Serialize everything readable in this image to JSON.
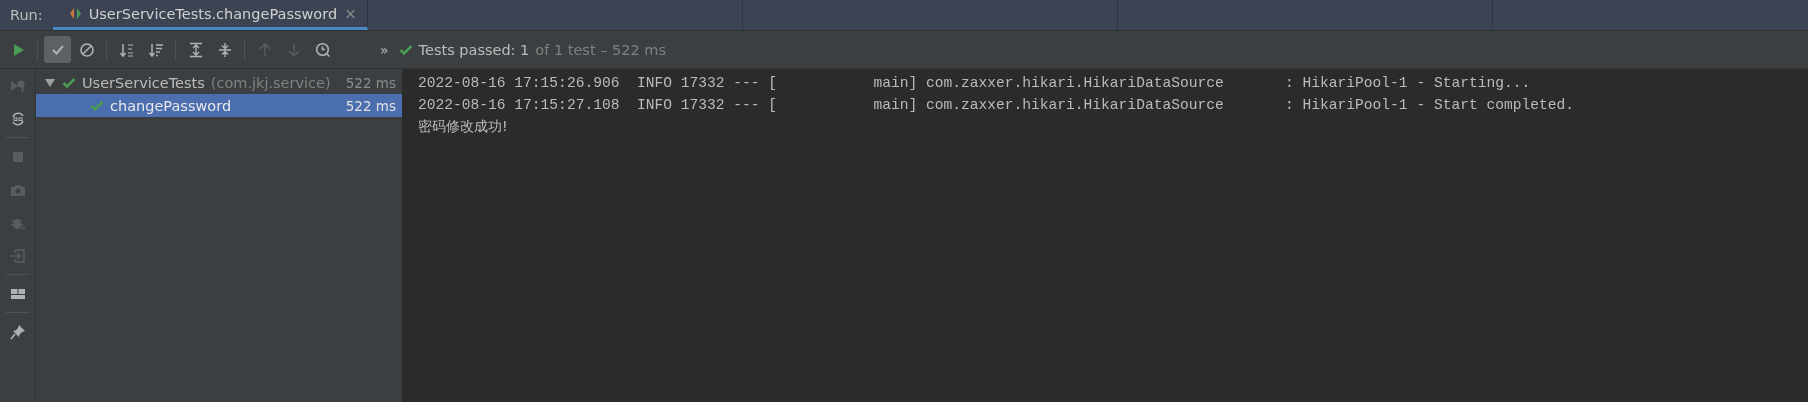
{
  "run_label": "Run:",
  "tabs": [
    {
      "title": "UserServiceTests.changePassword",
      "selected": true,
      "close": "×"
    }
  ],
  "toolbar": [
    {
      "kind": "run",
      "disabled": false,
      "pressed": false
    },
    {
      "kind": "show-passed",
      "disabled": false,
      "pressed": true
    },
    {
      "kind": "show-ignored",
      "disabled": false,
      "pressed": false
    },
    {
      "kind": "sort-alpha",
      "disabled": false,
      "pressed": false
    },
    {
      "kind": "sort-duration",
      "disabled": false,
      "pressed": false
    },
    {
      "kind": "expand-all",
      "disabled": false,
      "pressed": false
    },
    {
      "kind": "collapse-all",
      "disabled": false,
      "pressed": false
    },
    {
      "kind": "prev",
      "disabled": true,
      "pressed": false
    },
    {
      "kind": "next",
      "disabled": true,
      "pressed": false
    },
    {
      "kind": "history",
      "disabled": false,
      "pressed": false
    }
  ],
  "more": "»",
  "status": {
    "passed": true,
    "label": "Tests passed: 1",
    "detail": "of 1 test – 522 ms"
  },
  "side_tools": [
    {
      "kind": "rerun-failed",
      "disabled": true
    },
    {
      "kind": "auto-test",
      "disabled": false
    },
    {
      "kind": "stop",
      "disabled": true
    },
    {
      "kind": "camera",
      "disabled": true
    },
    {
      "kind": "debug",
      "disabled": true
    },
    {
      "kind": "import",
      "disabled": true
    },
    {
      "kind": "layout",
      "disabled": false
    },
    {
      "kind": "pin",
      "disabled": false
    }
  ],
  "tree": [
    {
      "name": "UserServiceTests",
      "package": "(com.jkj.service)",
      "duration": "522 ms",
      "passed": true,
      "expanded": true,
      "selected": false,
      "children": [
        {
          "name": "changePassword",
          "duration": "522 ms",
          "passed": true,
          "selected": true
        }
      ]
    }
  ],
  "console": [
    "2022-08-16 17:15:26.906  INFO 17332 --- [           main] com.zaxxer.hikari.HikariDataSource       : HikariPool-1 - Starting...",
    "2022-08-16 17:15:27.108  INFO 17332 --- [           main] com.zaxxer.hikari.HikariDataSource       : HikariPool-1 - Start completed.",
    "密码修改成功!"
  ]
}
